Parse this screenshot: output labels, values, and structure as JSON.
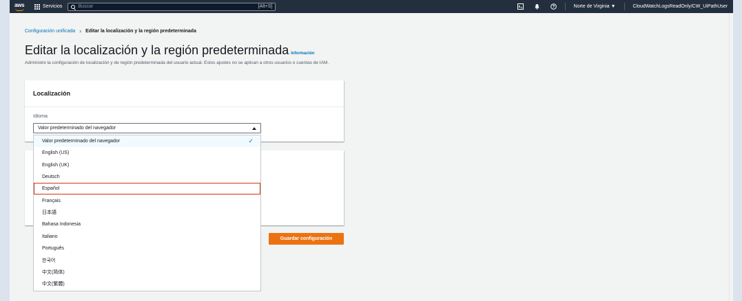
{
  "topnav": {
    "logo": "aws",
    "services_label": "Servicios",
    "search_placeholder": "Buscar",
    "search_shortcut": "[Alt+S]",
    "region": "Norte de Virginia ▼",
    "account": "CloudWatchLogsReadOnly/CW_UiPathUser",
    "icons": [
      "cloudshell-icon",
      "notifications-icon",
      "help-icon"
    ]
  },
  "breadcrumb": {
    "parent": "Configuración unificada",
    "current": "Editar la localización y la región predeterminada"
  },
  "page": {
    "title": "Editar la localización y la región predeterminada",
    "info_link": "Información",
    "description": "Administre la configuración de localización y de región predeterminada del usuario actual. Estos ajustes no se aplican a otros usuarios o cuentas de IAM."
  },
  "localization": {
    "heading": "Localización",
    "language_label": "Idioma",
    "selected_value": "Valor predeterminado del navegador",
    "options": [
      "Valor predeterminado del navegador",
      "English (US)",
      "English (UK)",
      "Deutsch",
      "Español",
      "Français",
      "日本語",
      "Bahasa Indonesia",
      "Italiano",
      "Português",
      "한국어",
      "中文(简体)",
      "中文(繁體)"
    ],
    "highlighted_option": "Español"
  },
  "actions": {
    "save_label": "Guardar configuración"
  },
  "colors": {
    "nav_bg": "#232f3e",
    "link": "#0073bb",
    "primary_button": "#ec7211",
    "highlight_border": "#d13212"
  }
}
